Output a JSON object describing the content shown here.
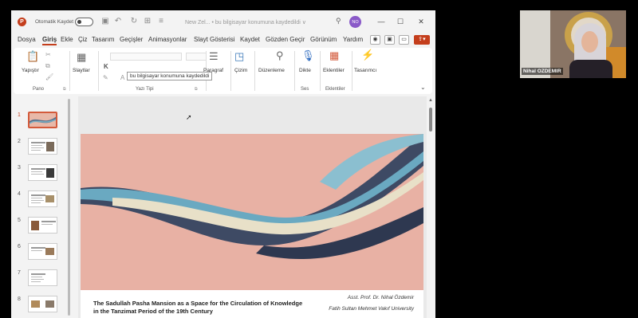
{
  "app": {
    "logo_letter": "P",
    "autosave_label": "Otomatik Kaydet",
    "doc_title": "New Zel... • bu bilgisayar konumuna kaydedildi ∨",
    "user_initials": "NO",
    "minimize": "—",
    "maximize": "☐",
    "close": "✕"
  },
  "menu": {
    "tabs": [
      "Dosya",
      "Giriş",
      "Ekle",
      "Çiz",
      "Tasarım",
      "Geçişler",
      "Animasyonlar",
      "Slayt Gösterisi",
      "Kaydet",
      "Gözden Geçir",
      "Görünüm",
      "Yardım"
    ],
    "active_tab": "Giriş"
  },
  "ribbon": {
    "paste_label": "Yapıştır",
    "clipboard_group": "Pano",
    "slides_label": "Slaytlar",
    "font_group": "Yazı Tipi",
    "bold_label": "K",
    "font_grow": "A^",
    "font_shrink": "Aˇ",
    "font_case": "Aa",
    "paragraph_label": "Paragraf",
    "drawing_label": "Çizim",
    "editing_label": "Düzenleme",
    "dictate_label": "Dikte",
    "voice_group": "Ses",
    "addins_label": "Eklentiler",
    "addins_group": "Eklentiler",
    "designer_label": "Tasarımcı",
    "tooltip": "bu bilgisayar konumuna kaydedildi"
  },
  "thumbnails": {
    "numbers": [
      "1",
      "2",
      "3",
      "4",
      "5",
      "6",
      "7",
      "8",
      "9"
    ],
    "selected": "1"
  },
  "slide": {
    "title": "The Sadullah Pasha Mansion as a Space for the Circulation of Knowledge in the Tanzimat Period of the 19th Century",
    "author": "Asst. Prof. Dr. Nihal Özdemir",
    "institution": "Fatih Sultan Mehmet Vakıf University"
  },
  "webcam": {
    "participant_name": "Nihal OZDEMIR"
  },
  "colors": {
    "accent": "#c43e1c",
    "slide_background": "#e8b1a4",
    "ribbon_teal": "#6aa9c1",
    "ribbon_navy": "#3e4a64",
    "ribbon_cream": "#e8e0c8"
  }
}
